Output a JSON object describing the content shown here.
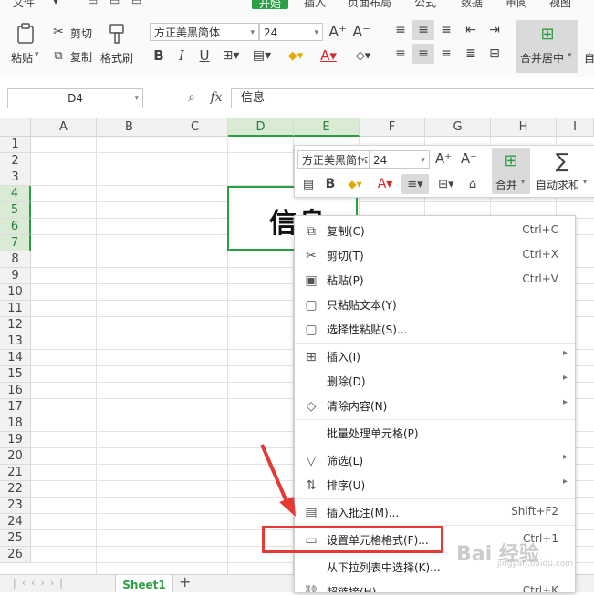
{
  "menu": {
    "items": [
      {
        "label": "文件"
      },
      {
        "label": "开始"
      },
      {
        "label": "插入"
      },
      {
        "label": "页面布局"
      },
      {
        "label": "公式"
      },
      {
        "label": "数据"
      },
      {
        "label": "审阅"
      },
      {
        "label": "视图"
      }
    ],
    "active_index": 1
  },
  "ribbon": {
    "paste_label": "粘贴",
    "cut_label": "剪切",
    "copy_label": "复制",
    "format_painter_label": "格式刷",
    "font_name": "方正美黑简体",
    "font_size": "24",
    "merge_center_label": "合并居中",
    "auto_label": "自"
  },
  "formula_bar": {
    "cell_ref": "D4",
    "fx_label": "fx",
    "content": "信息"
  },
  "grid": {
    "columns": [
      "A",
      "B",
      "C",
      "D",
      "E",
      "F",
      "G",
      "H",
      "I"
    ],
    "rows": [
      "1",
      "2",
      "3",
      "4",
      "5",
      "6",
      "7",
      "8",
      "9",
      "10",
      "11",
      "12",
      "13",
      "14",
      "15",
      "16",
      "17",
      "18",
      "19",
      "20",
      "21",
      "22",
      "23",
      "24",
      "25",
      "26"
    ],
    "merged_cell_text": "信息"
  },
  "mini_toolbar": {
    "font_name": "方正美黑简体",
    "font_size": "24",
    "merge_label": "合并",
    "autosum_label": "自动求和"
  },
  "context_menu": {
    "items": [
      {
        "icon": "copy-icon",
        "label": "复制(C)",
        "shortcut": "Ctrl+C",
        "submenu": false
      },
      {
        "icon": "cut-icon",
        "label": "剪切(T)",
        "shortcut": "Ctrl+X",
        "submenu": false
      },
      {
        "icon": "paste-icon",
        "label": "粘贴(P)",
        "shortcut": "Ctrl+V",
        "submenu": false
      },
      {
        "icon": "paste-text-icon",
        "label": "只粘贴文本(Y)",
        "shortcut": "",
        "submenu": false
      },
      {
        "icon": "paste-special-icon",
        "label": "选择性粘贴(S)...",
        "shortcut": "",
        "submenu": false
      },
      {
        "icon": "insert-icon",
        "label": "插入(I)",
        "shortcut": "",
        "submenu": true
      },
      {
        "icon": "",
        "label": "删除(D)",
        "shortcut": "",
        "submenu": true
      },
      {
        "icon": "eraser-icon",
        "label": "清除内容(N)",
        "shortcut": "",
        "submenu": true
      },
      {
        "icon": "",
        "label": "批量处理单元格(P)",
        "shortcut": "",
        "submenu": false
      },
      {
        "icon": "filter-icon",
        "label": "筛选(L)",
        "shortcut": "",
        "submenu": true
      },
      {
        "icon": "sort-icon",
        "label": "排序(U)",
        "shortcut": "",
        "submenu": true
      },
      {
        "icon": "comment-icon",
        "label": "插入批注(M)...",
        "shortcut": "Shift+F2",
        "submenu": false
      },
      {
        "icon": "format-cells-icon",
        "label": "设置单元格格式(F)...",
        "shortcut": "Ctrl+1",
        "submenu": false
      },
      {
        "icon": "",
        "label": "从下拉列表中选择(K)...",
        "shortcut": "",
        "submenu": false
      },
      {
        "icon": "link-icon",
        "label": "超链接(H)...",
        "shortcut": "Ctrl+K",
        "submenu": false
      }
    ]
  },
  "sheet_tabs": {
    "active": "Sheet1",
    "add_label": "+"
  },
  "watermark": {
    "main": "Bai 经验",
    "sub": "jingyan.baidu.com"
  },
  "colors": {
    "accent": "#2c9f45",
    "highlight_box": "#e53935",
    "arrow": "#e53935"
  }
}
